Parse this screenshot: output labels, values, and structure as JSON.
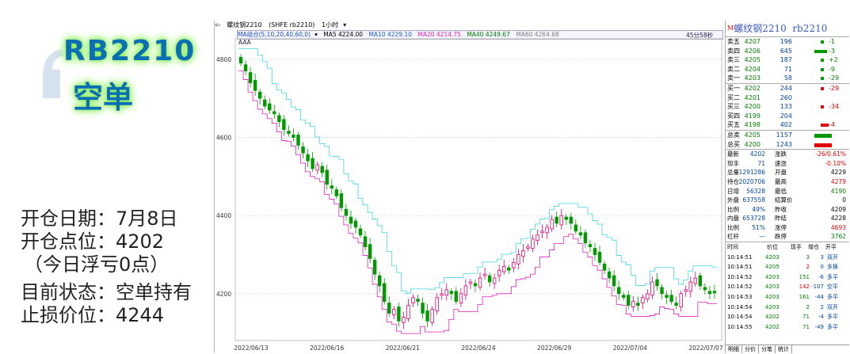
{
  "promo": {
    "title_line1": "RB2210",
    "title_line2": "空单"
  },
  "trade_info": [
    "开仓日期：7月8日",
    "开仓点位：4202",
    "（今日浮亏0点）",
    "目前状态：空单持有",
    "止损价位：4244"
  ],
  "chart": {
    "toolbar": {
      "back_icon": "back-arrow-icon",
      "instrument": "螺纹钢2210",
      "exchange": "(SHFE rb2210)",
      "period": "1小时"
    },
    "ma_row": {
      "label": "MA组合(5,10,20,40,60,0)",
      "ma5": "MA5 4224.00",
      "ma10": "MA10 4229.10",
      "ma20": "MA20 4214.75",
      "ma40": "MA40 4249.67",
      "ma60": "MA60 4264.68"
    },
    "sub_label": "AAA",
    "period_indicator": "45分58秒",
    "colors": {
      "up": "#e0007a",
      "down": "#009a00",
      "ma_cyan": "#40d4e8",
      "ma_magenta": "#e020c0",
      "grid": "#c8c8c8"
    }
  },
  "chart_data": {
    "type": "candlestick",
    "y_ticks": [
      4800,
      4600,
      4400,
      4200
    ],
    "ylim": [
      4080,
      4830
    ],
    "x_ticks": [
      "2022/06/13",
      "2022/06/16",
      "2022/06/21",
      "2022/06/24",
      "2022/06/29",
      "2022/07/04",
      "2022/07/07"
    ],
    "close_series": [
      4790,
      4770,
      4740,
      4720,
      4700,
      4680,
      4670,
      4660,
      4640,
      4620,
      4610,
      4600,
      4580,
      4560,
      4540,
      4520,
      4530,
      4510,
      4480,
      4470,
      4450,
      4420,
      4400,
      4380,
      4370,
      4350,
      4320,
      4290,
      4250,
      4220,
      4180,
      4150,
      4160,
      4130,
      4140,
      4170,
      4190,
      4180,
      4150,
      4130,
      4160,
      4190,
      4200,
      4210,
      4200,
      4180,
      4200,
      4220,
      4230,
      4220,
      4240,
      4250,
      4230,
      4240,
      4260,
      4270,
      4260,
      4280,
      4300,
      4310,
      4320,
      4340,
      4350,
      4360,
      4370,
      4390,
      4380,
      4400,
      4390,
      4380,
      4360,
      4350,
      4330,
      4320,
      4300,
      4280,
      4260,
      4240,
      4220,
      4200,
      4190,
      4170,
      4180,
      4170,
      4190,
      4200,
      4230,
      4220,
      4200,
      4190,
      4180,
      4170,
      4200,
      4210,
      4230,
      4240,
      4220,
      4210,
      4200,
      4202
    ]
  },
  "quote": {
    "instrument_name": "螺纹钢2210",
    "instrument_code": "rb2210",
    "orderbook": [
      {
        "label": "卖五",
        "price": "4207",
        "vol": "196",
        "chg": "-1"
      },
      {
        "label": "卖四",
        "price": "4206",
        "vol": "645",
        "chg": "-3"
      },
      {
        "label": "卖三",
        "price": "4205",
        "vol": "187",
        "chg": "+2"
      },
      {
        "label": "卖二",
        "price": "4204",
        "vol": "71",
        "chg": "-9"
      },
      {
        "label": "卖一",
        "price": "4203",
        "vol": "58",
        "chg": "-29"
      },
      {
        "label": "买一",
        "price": "4202",
        "vol": "244",
        "chg": "-29"
      },
      {
        "label": "买二",
        "price": "4201",
        "vol": "260",
        "chg": ""
      },
      {
        "label": "买三",
        "price": "4200",
        "vol": "133",
        "chg": "-34"
      },
      {
        "label": "买四",
        "price": "4199",
        "vol": "204",
        "chg": ""
      },
      {
        "label": "买五",
        "price": "4198",
        "vol": "402",
        "chg": "-4"
      }
    ],
    "totals": [
      {
        "label": "总卖",
        "price": "4205",
        "vol": "1157"
      },
      {
        "label": "总买",
        "price": "4200",
        "vol": "1243"
      }
    ],
    "stats": [
      {
        "l1": "最新",
        "v1": "4202",
        "l2": "涨跌",
        "v2": "-26/0.61%"
      },
      {
        "l1": "现手",
        "v1": "71",
        "l2": "速涨",
        "v2": "-0.10%"
      },
      {
        "l1": "总量",
        "v1": "1291286",
        "l2": "开盘",
        "v2": "4229"
      },
      {
        "l1": "持仓",
        "v1": "2020706",
        "l2": "最高",
        "v2": "4279"
      },
      {
        "l1": "日增",
        "v1": "56328",
        "l2": "最低",
        "v2": "4190"
      },
      {
        "l1": "外盘",
        "v1": "637558",
        "l2": "结算价",
        "v2": "0"
      },
      {
        "l1": "比例",
        "v1": "49%",
        "l2": "昨收",
        "v2": "4209"
      },
      {
        "l1": "内盘",
        "v1": "653728",
        "l2": "昨结",
        "v2": "4228"
      },
      {
        "l1": "比例",
        "v1": "51%",
        "l2": "涨停",
        "v2": "4693"
      },
      {
        "l1": "杠杆",
        "v1": "—",
        "l2": "跌停",
        "v2": "3762"
      }
    ],
    "tick_header": {
      "time": "时间",
      "price": "价位",
      "qty": "现手",
      "add": "增仓",
      "type": "开平"
    },
    "ticks": [
      {
        "time": "10:14:51",
        "price": "4203",
        "qty": "3",
        "add": "3",
        "type": "双开"
      },
      {
        "time": "10:14:51",
        "price": "4205",
        "qty": "2",
        "add": "0",
        "type": "多换"
      },
      {
        "time": "10:14:52",
        "price": "4203",
        "qty": "151",
        "add": "-6",
        "type": "多平"
      },
      {
        "time": "10:14:52",
        "price": "4203",
        "qty": "142",
        "add": "-107",
        "type": "空平"
      },
      {
        "time": "10:14:53",
        "price": "4203",
        "qty": "161",
        "add": "-44",
        "type": "多平"
      },
      {
        "time": "10:14:54",
        "price": "4203",
        "qty": "2",
        "add": "2",
        "type": "双开"
      },
      {
        "time": "10:14:54",
        "price": "4202",
        "qty": "71",
        "add": "-4",
        "type": "多平"
      },
      {
        "time": "10:14:55",
        "price": "4202",
        "qty": "71",
        "add": "-49",
        "type": "多平"
      }
    ],
    "tabs": [
      "明细",
      "分价",
      "分笔",
      "统计"
    ]
  }
}
